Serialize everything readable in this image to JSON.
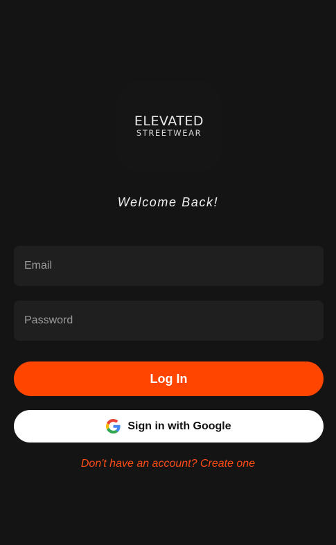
{
  "logo": {
    "line1": "ELEVATED",
    "line2": "STREETWEAR"
  },
  "welcome_text": "Welcome Back!",
  "form": {
    "email_placeholder": "Email",
    "password_placeholder": "Password",
    "email_value": "",
    "password_value": ""
  },
  "buttons": {
    "login_label": "Log In",
    "google_label": "Sign in with Google"
  },
  "signup_link": "Don't have an account? Create one",
  "colors": {
    "background": "#141414",
    "accent": "#ff4500",
    "field_bg": "#1f1f1f"
  },
  "icons": {
    "google": "google-g-icon"
  }
}
